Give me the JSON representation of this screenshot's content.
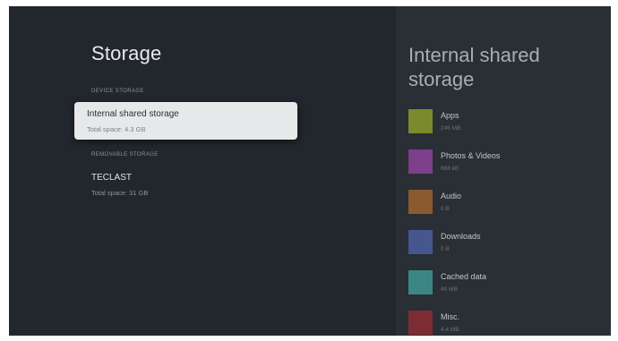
{
  "page_title": "Storage",
  "device_storage": {
    "header": "DEVICE STORAGE",
    "item": {
      "name": "Internal shared storage",
      "subtitle": "Total space: 4.3 GB"
    }
  },
  "removable_storage": {
    "header": "REMOVABLE STORAGE",
    "item": {
      "name": "TECLAST",
      "subtitle": "Total space: 31 GB"
    }
  },
  "detail": {
    "title": "Internal shared storage",
    "categories": [
      {
        "label": "Apps",
        "size": "245 MB",
        "color": "#7a8a2c"
      },
      {
        "label": "Photos & Videos",
        "size": "868 kB",
        "color": "#7d3f8a"
      },
      {
        "label": "Audio",
        "size": "0 B",
        "color": "#8b5a2e"
      },
      {
        "label": "Downloads",
        "size": "0 B",
        "color": "#46568e"
      },
      {
        "label": "Cached data",
        "size": "40 MB",
        "color": "#3b8684"
      },
      {
        "label": "Misc.",
        "size": "4.4 MB",
        "color": "#7c2d33"
      }
    ]
  }
}
